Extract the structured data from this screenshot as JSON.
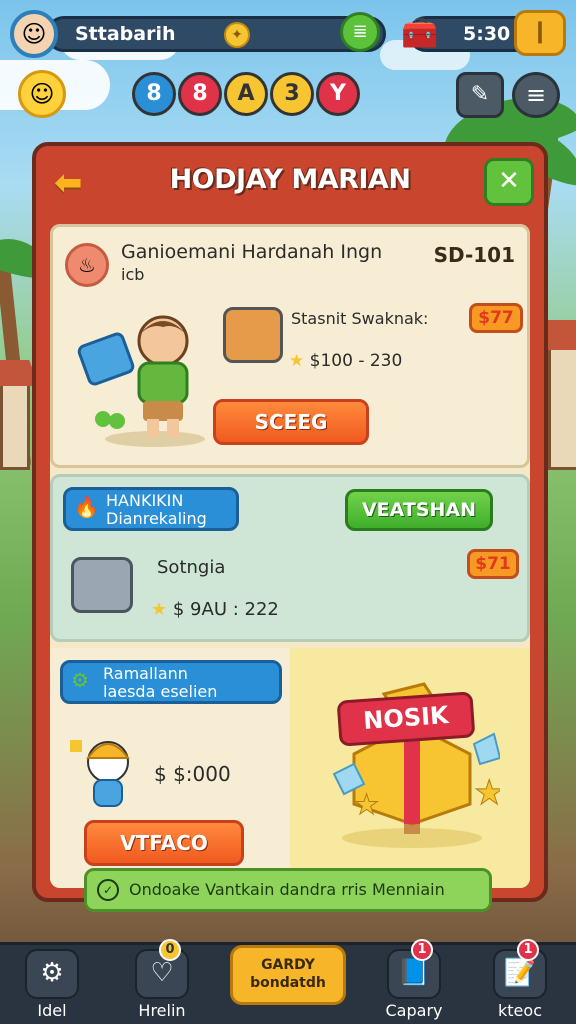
{
  "player": {
    "name": "Sttabarih"
  },
  "hud": {
    "time": "5:30"
  },
  "bubbles": [
    "8",
    "8",
    "A",
    "3",
    "Y"
  ],
  "panel": {
    "title": "HODJAY MARIAN"
  },
  "offer1": {
    "title": "Ganioemani Hardanah Ingn",
    "subtitle": "icb",
    "code": "SD-101",
    "item_name": "Stasnit Swaknak:",
    "price_badge": "$77",
    "range": "$100 - 230",
    "action": "SCEEG"
  },
  "offer2": {
    "tag_line1": "HANKIKIN",
    "tag_line2": "Dianrekaling",
    "action": "VEATSHAN",
    "item_name": "Sotngia",
    "price_badge": "$71",
    "range": "$ 9AU : 222"
  },
  "offer3": {
    "tag_line1": "Ramallann",
    "tag_line2": "laesda eselien",
    "price": "$ $:000",
    "action": "VTFACO"
  },
  "offer4": {
    "label": "NOSIK"
  },
  "footer_banner": "Ondoake Vantkain dandra rris Menniain",
  "nav": {
    "items": [
      {
        "label": "Idel",
        "icon": "gear-icon"
      },
      {
        "label": "Hrelin",
        "icon": "heart-icon",
        "badge": "0"
      },
      {
        "label": "GARDY\nbondatdh",
        "icon": ""
      },
      {
        "label": "Capary",
        "icon": "book-icon",
        "badge": "1"
      },
      {
        "label": "kteoc",
        "icon": "notebook-icon",
        "badge": "1"
      }
    ]
  },
  "colors": {
    "panel": "#c9452e",
    "accent": "#f7b52a",
    "button_orange": "#f05a1f",
    "button_green": "#3fae2b",
    "tag_blue": "#2a8fd6"
  }
}
